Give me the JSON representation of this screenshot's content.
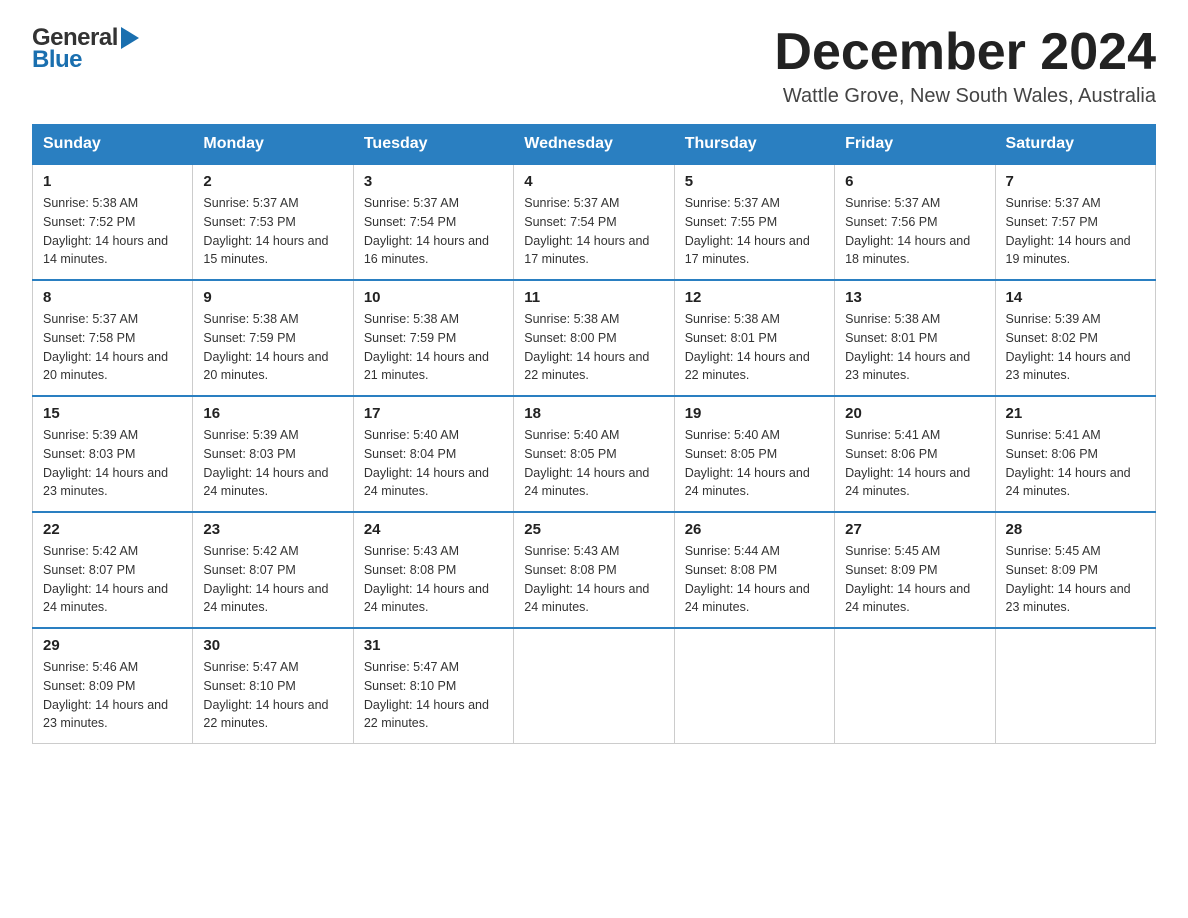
{
  "header": {
    "logo_general": "General",
    "logo_blue": "Blue",
    "month_title": "December 2024",
    "location": "Wattle Grove, New South Wales, Australia"
  },
  "days_of_week": [
    "Sunday",
    "Monday",
    "Tuesday",
    "Wednesday",
    "Thursday",
    "Friday",
    "Saturday"
  ],
  "weeks": [
    [
      {
        "num": "1",
        "sunrise": "5:38 AM",
        "sunset": "7:52 PM",
        "daylight": "14 hours and 14 minutes."
      },
      {
        "num": "2",
        "sunrise": "5:37 AM",
        "sunset": "7:53 PM",
        "daylight": "14 hours and 15 minutes."
      },
      {
        "num": "3",
        "sunrise": "5:37 AM",
        "sunset": "7:54 PM",
        "daylight": "14 hours and 16 minutes."
      },
      {
        "num": "4",
        "sunrise": "5:37 AM",
        "sunset": "7:54 PM",
        "daylight": "14 hours and 17 minutes."
      },
      {
        "num": "5",
        "sunrise": "5:37 AM",
        "sunset": "7:55 PM",
        "daylight": "14 hours and 17 minutes."
      },
      {
        "num": "6",
        "sunrise": "5:37 AM",
        "sunset": "7:56 PM",
        "daylight": "14 hours and 18 minutes."
      },
      {
        "num": "7",
        "sunrise": "5:37 AM",
        "sunset": "7:57 PM",
        "daylight": "14 hours and 19 minutes."
      }
    ],
    [
      {
        "num": "8",
        "sunrise": "5:37 AM",
        "sunset": "7:58 PM",
        "daylight": "14 hours and 20 minutes."
      },
      {
        "num": "9",
        "sunrise": "5:38 AM",
        "sunset": "7:59 PM",
        "daylight": "14 hours and 20 minutes."
      },
      {
        "num": "10",
        "sunrise": "5:38 AM",
        "sunset": "7:59 PM",
        "daylight": "14 hours and 21 minutes."
      },
      {
        "num": "11",
        "sunrise": "5:38 AM",
        "sunset": "8:00 PM",
        "daylight": "14 hours and 22 minutes."
      },
      {
        "num": "12",
        "sunrise": "5:38 AM",
        "sunset": "8:01 PM",
        "daylight": "14 hours and 22 minutes."
      },
      {
        "num": "13",
        "sunrise": "5:38 AM",
        "sunset": "8:01 PM",
        "daylight": "14 hours and 23 minutes."
      },
      {
        "num": "14",
        "sunrise": "5:39 AM",
        "sunset": "8:02 PM",
        "daylight": "14 hours and 23 minutes."
      }
    ],
    [
      {
        "num": "15",
        "sunrise": "5:39 AM",
        "sunset": "8:03 PM",
        "daylight": "14 hours and 23 minutes."
      },
      {
        "num": "16",
        "sunrise": "5:39 AM",
        "sunset": "8:03 PM",
        "daylight": "14 hours and 24 minutes."
      },
      {
        "num": "17",
        "sunrise": "5:40 AM",
        "sunset": "8:04 PM",
        "daylight": "14 hours and 24 minutes."
      },
      {
        "num": "18",
        "sunrise": "5:40 AM",
        "sunset": "8:05 PM",
        "daylight": "14 hours and 24 minutes."
      },
      {
        "num": "19",
        "sunrise": "5:40 AM",
        "sunset": "8:05 PM",
        "daylight": "14 hours and 24 minutes."
      },
      {
        "num": "20",
        "sunrise": "5:41 AM",
        "sunset": "8:06 PM",
        "daylight": "14 hours and 24 minutes."
      },
      {
        "num": "21",
        "sunrise": "5:41 AM",
        "sunset": "8:06 PM",
        "daylight": "14 hours and 24 minutes."
      }
    ],
    [
      {
        "num": "22",
        "sunrise": "5:42 AM",
        "sunset": "8:07 PM",
        "daylight": "14 hours and 24 minutes."
      },
      {
        "num": "23",
        "sunrise": "5:42 AM",
        "sunset": "8:07 PM",
        "daylight": "14 hours and 24 minutes."
      },
      {
        "num": "24",
        "sunrise": "5:43 AM",
        "sunset": "8:08 PM",
        "daylight": "14 hours and 24 minutes."
      },
      {
        "num": "25",
        "sunrise": "5:43 AM",
        "sunset": "8:08 PM",
        "daylight": "14 hours and 24 minutes."
      },
      {
        "num": "26",
        "sunrise": "5:44 AM",
        "sunset": "8:08 PM",
        "daylight": "14 hours and 24 minutes."
      },
      {
        "num": "27",
        "sunrise": "5:45 AM",
        "sunset": "8:09 PM",
        "daylight": "14 hours and 24 minutes."
      },
      {
        "num": "28",
        "sunrise": "5:45 AM",
        "sunset": "8:09 PM",
        "daylight": "14 hours and 23 minutes."
      }
    ],
    [
      {
        "num": "29",
        "sunrise": "5:46 AM",
        "sunset": "8:09 PM",
        "daylight": "14 hours and 23 minutes."
      },
      {
        "num": "30",
        "sunrise": "5:47 AM",
        "sunset": "8:10 PM",
        "daylight": "14 hours and 22 minutes."
      },
      {
        "num": "31",
        "sunrise": "5:47 AM",
        "sunset": "8:10 PM",
        "daylight": "14 hours and 22 minutes."
      },
      null,
      null,
      null,
      null
    ]
  ]
}
